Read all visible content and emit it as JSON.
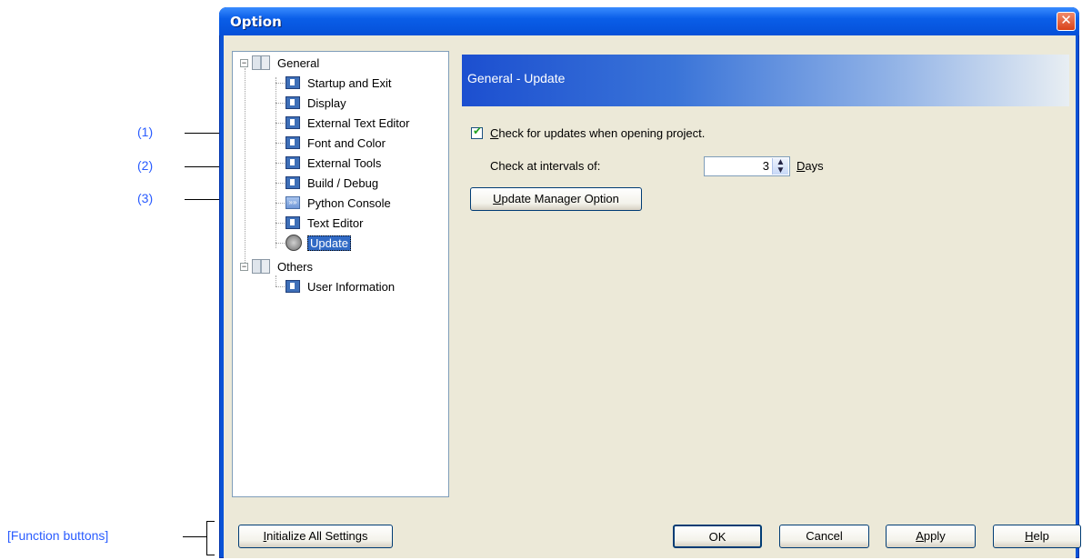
{
  "annotations": {
    "c1": "(1)",
    "c2": "(2)",
    "c3": "(3)",
    "function_buttons": "[Function buttons]"
  },
  "window": {
    "title": "Option",
    "close_glyph": "✕"
  },
  "tree": {
    "general": "General",
    "items": [
      "Startup and Exit",
      "Display",
      "External Text Editor",
      "Font and Color",
      "External Tools",
      "Build / Debug",
      "Python Console",
      "Text Editor",
      "Update"
    ],
    "others": "Others",
    "others_items": [
      "User Information"
    ],
    "collapse_glyph": "−",
    "python_icon_glyph": "»»"
  },
  "panel": {
    "header": "General - Update",
    "check_updates": {
      "label_prefix": "C",
      "label_rest": "heck for updates when opening project.",
      "checked": true
    },
    "interval_label": "Check at intervals of:",
    "interval_value": "3",
    "days_prefix": "D",
    "days_rest": "ays",
    "update_manager_prefix": "U",
    "update_manager_rest": "pdate Manager Option",
    "spin_up": "▲",
    "spin_down": "▼"
  },
  "footer": {
    "init_prefix": "I",
    "init_rest": "nitialize All Settings",
    "ok": "OK",
    "cancel": "Cancel",
    "apply_prefix": "A",
    "apply_rest": "pply",
    "help_prefix": "H",
    "help_rest": "elp"
  },
  "colors": {
    "accent": "#0a53d6",
    "selection": "#316ac5",
    "callout": "#2a5cff"
  }
}
